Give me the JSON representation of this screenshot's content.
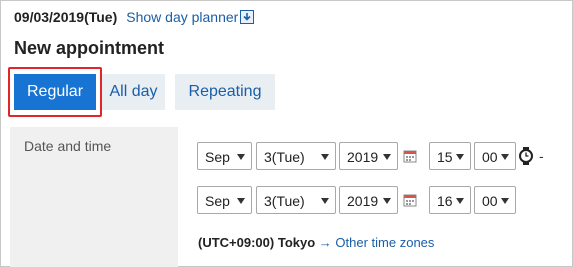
{
  "header": {
    "date": "09/03/2019(Tue)",
    "planner_link": "Show day planner"
  },
  "page_title": "New appointment",
  "tabs": [
    {
      "label": "Regular",
      "selected": true
    },
    {
      "label": "All day",
      "selected": false
    },
    {
      "label": "Repeating",
      "selected": false
    }
  ],
  "form": {
    "date_time_label": "Date and time",
    "start": {
      "month": "Sep",
      "day": "3(Tue)",
      "year": "2019",
      "hour": "15",
      "minute": "00"
    },
    "end": {
      "month": "Sep",
      "day": "3(Tue)",
      "year": "2019",
      "hour": "16",
      "minute": "00"
    },
    "range_separator": "-",
    "timezone": {
      "offset": "(UTC+09:00)",
      "city": "Tokyo",
      "arrow": "→",
      "link": "Other time zones"
    }
  },
  "colors": {
    "accent": "#1774d3",
    "link": "#1a5ea8",
    "highlight_border": "#e0262b",
    "tab_bg": "#e9eef3",
    "label_cell_bg": "#f0f0f0"
  },
  "icons": {
    "planner": "download-arrow-icon",
    "date_picker": "calendar-icon",
    "time": "clock-icon"
  }
}
